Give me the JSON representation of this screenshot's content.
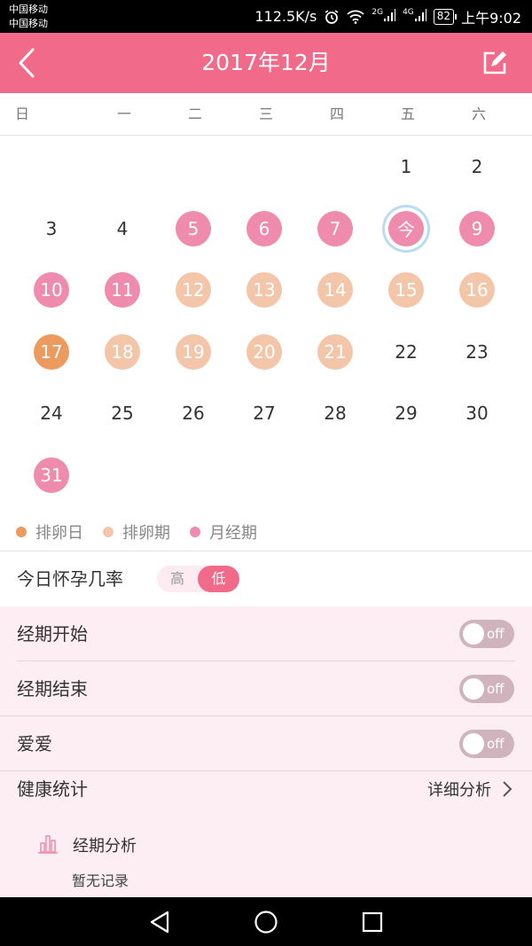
{
  "status_bar": {
    "carrier_1": "中国移动",
    "carrier_2": "中国移动",
    "speed": "112.5K/s",
    "net_2g": "2G",
    "net_4g": "4G",
    "battery": "82",
    "time": "上午9:02"
  },
  "header": {
    "title": "2017年12月",
    "back_icon": "chevron-left-icon",
    "edit_icon": "edit-icon"
  },
  "weekdays": [
    "日",
    "一",
    "二",
    "三",
    "四",
    "五",
    "六"
  ],
  "calendar": {
    "days": [
      {
        "label": "1",
        "col": 5,
        "row": 0,
        "type": "none"
      },
      {
        "label": "2",
        "col": 6,
        "row": 0,
        "type": "none"
      },
      {
        "label": "3",
        "col": 0,
        "row": 1,
        "type": "none"
      },
      {
        "label": "4",
        "col": 1,
        "row": 1,
        "type": "none"
      },
      {
        "label": "5",
        "col": 2,
        "row": 1,
        "type": "period"
      },
      {
        "label": "6",
        "col": 3,
        "row": 1,
        "type": "period"
      },
      {
        "label": "7",
        "col": 4,
        "row": 1,
        "type": "period"
      },
      {
        "label": "今",
        "col": 5,
        "row": 1,
        "type": "today"
      },
      {
        "label": "9",
        "col": 6,
        "row": 1,
        "type": "period"
      },
      {
        "label": "10",
        "col": 0,
        "row": 2,
        "type": "period"
      },
      {
        "label": "11",
        "col": 1,
        "row": 2,
        "type": "period"
      },
      {
        "label": "12",
        "col": 2,
        "row": 2,
        "type": "ovulation-period"
      },
      {
        "label": "13",
        "col": 3,
        "row": 2,
        "type": "ovulation-period"
      },
      {
        "label": "14",
        "col": 4,
        "row": 2,
        "type": "ovulation-period"
      },
      {
        "label": "15",
        "col": 5,
        "row": 2,
        "type": "ovulation-period"
      },
      {
        "label": "16",
        "col": 6,
        "row": 2,
        "type": "ovulation-period"
      },
      {
        "label": "17",
        "col": 0,
        "row": 3,
        "type": "ovulation-day"
      },
      {
        "label": "18",
        "col": 1,
        "row": 3,
        "type": "ovulation-period"
      },
      {
        "label": "19",
        "col": 2,
        "row": 3,
        "type": "ovulation-period"
      },
      {
        "label": "20",
        "col": 3,
        "row": 3,
        "type": "ovulation-period"
      },
      {
        "label": "21",
        "col": 4,
        "row": 3,
        "type": "ovulation-period"
      },
      {
        "label": "22",
        "col": 5,
        "row": 3,
        "type": "none"
      },
      {
        "label": "23",
        "col": 6,
        "row": 3,
        "type": "none"
      },
      {
        "label": "24",
        "col": 0,
        "row": 4,
        "type": "none"
      },
      {
        "label": "25",
        "col": 1,
        "row": 4,
        "type": "none"
      },
      {
        "label": "26",
        "col": 2,
        "row": 4,
        "type": "none"
      },
      {
        "label": "27",
        "col": 3,
        "row": 4,
        "type": "none"
      },
      {
        "label": "28",
        "col": 4,
        "row": 4,
        "type": "none"
      },
      {
        "label": "29",
        "col": 5,
        "row": 4,
        "type": "none"
      },
      {
        "label": "30",
        "col": 6,
        "row": 4,
        "type": "none"
      },
      {
        "label": "31",
        "col": 0,
        "row": 5,
        "type": "period"
      }
    ]
  },
  "legend": {
    "ovulation_day": "排卵日",
    "ovulation_period": "排卵期",
    "menstrual_period": "月经期"
  },
  "colors": {
    "accent": "#f26a8a",
    "period": "#ef8bac",
    "ovulation_period": "#f3c6a9",
    "ovulation_day": "#ec9a5e",
    "today_ring": "#b9dbf5",
    "section_bg": "#fdeef3"
  },
  "pregnancy": {
    "label": "今日怀孕几率",
    "high": "高",
    "low": "低",
    "selected": "低"
  },
  "toggles": [
    {
      "label": "经期开始",
      "state": "off"
    },
    {
      "label": "经期结束",
      "state": "off"
    },
    {
      "label": "爱爱",
      "state": "off"
    }
  ],
  "health": {
    "label": "健康统计",
    "detail": "详细分析",
    "period_analysis": "经期分析",
    "no_record": "暂无记录"
  },
  "nav": {
    "back_icon": "triangle-back-icon",
    "home_icon": "circle-home-icon",
    "recent_icon": "square-recent-icon"
  }
}
